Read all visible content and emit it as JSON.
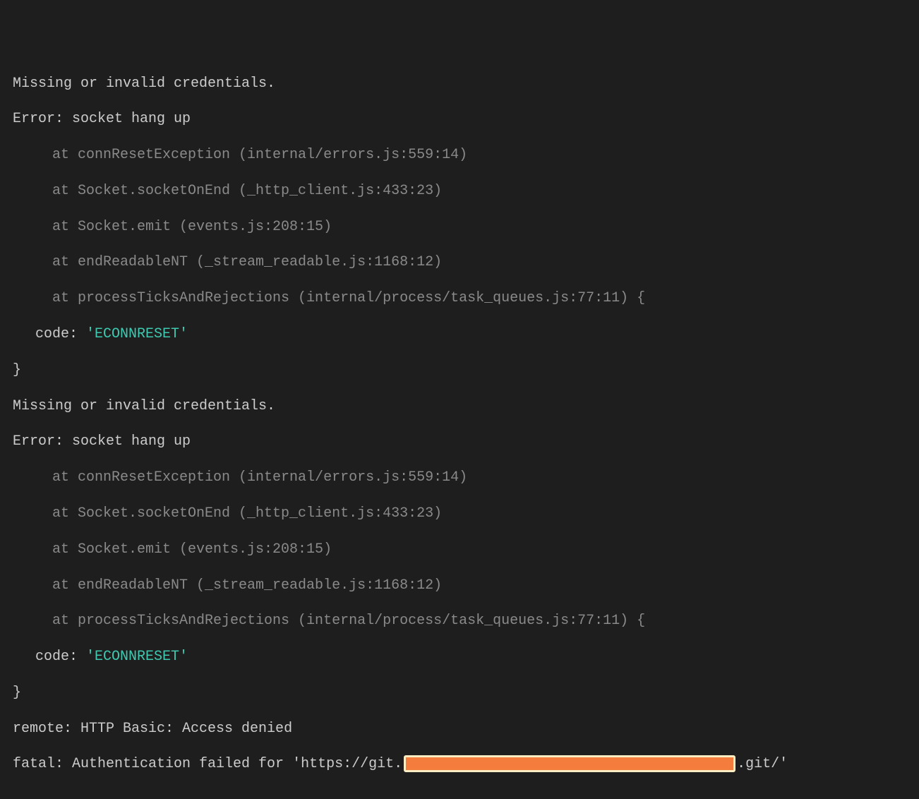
{
  "error1": {
    "missing": "Missing or invalid credentials.",
    "error_line": "Error: socket hang up",
    "trace": [
      "at connResetException (internal/errors.js:559:14)",
      "at Socket.socketOnEnd (_http_client.js:433:23)",
      "at Socket.emit (events.js:208:15)",
      "at endReadableNT (_stream_readable.js:1168:12)",
      "at processTicksAndRejections (internal/process/task_queues.js:77:11) {"
    ],
    "code_label": "code: ",
    "code_value": "'ECONNRESET'",
    "close": "}"
  },
  "error2": {
    "missing": "Missing or invalid credentials.",
    "error_line": "Error: socket hang up",
    "trace": [
      "at connResetException (internal/errors.js:559:14)",
      "at Socket.socketOnEnd (_http_client.js:433:23)",
      "at Socket.emit (events.js:208:15)",
      "at endReadableNT (_stream_readable.js:1168:12)",
      "at processTicksAndRejections (internal/process/task_queues.js:77:11) {"
    ],
    "code_label": "code: ",
    "code_value": "'ECONNRESET'",
    "close": "}"
  },
  "remote": "remote: HTTP Basic: Access denied",
  "fatal_prefix": "fatal: Authentication failed for 'https://git.",
  "fatal_suffix": ".git/'"
}
